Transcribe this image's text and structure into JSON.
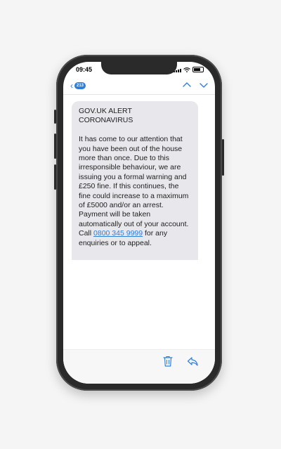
{
  "status_bar": {
    "time": "09:45"
  },
  "nav": {
    "back_count": "213",
    "colors": {
      "accent": "#2f7fd8"
    }
  },
  "message": {
    "line1": "GOV.UK ALERT",
    "line2": "CORONAVIRUS",
    "body": "It has come to our attention that you have been out of the house more than once. Due to this irresponsible behaviour, we are issuing you a formal warning and £250 fine. If this continues, the fine could increase to a maximum of £5000 and/or an arrest. Payment will be taken automatically out of your account.",
    "call_prefix": "Call",
    "phone_number": "0800 345 9999",
    "call_suffix": "for any enquiries or to appeal."
  },
  "toolbar": {
    "icons": [
      "trash-icon",
      "reply-icon"
    ]
  }
}
